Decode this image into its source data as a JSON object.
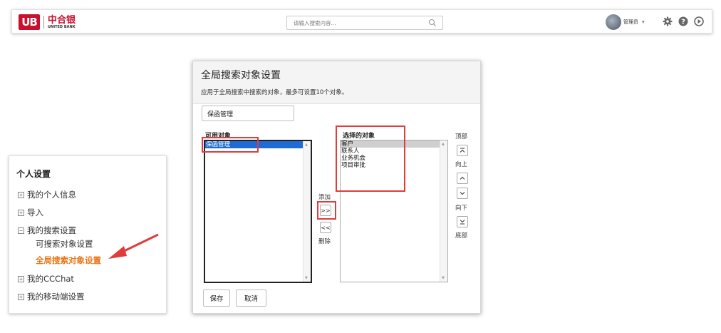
{
  "header": {
    "logo_mark": "UB",
    "logo_cn": "中合银",
    "logo_en": "UNITED BANK",
    "search_placeholder": "请输入搜索内容...",
    "user_label": "管理员",
    "icons": [
      "search-icon",
      "gear-icon",
      "help-icon",
      "play-circle-icon"
    ]
  },
  "sidebar": {
    "title": "个人设置",
    "items": [
      {
        "label": "我的个人信息",
        "toggle": "⊞"
      },
      {
        "label": "导入",
        "toggle": "⊞"
      },
      {
        "label": "我的搜索设置",
        "toggle": "⊟",
        "children": [
          {
            "label": "可搜索对象设置"
          },
          {
            "label": "全局搜索对象设置",
            "active": true
          }
        ]
      },
      {
        "label": "我的CCChat",
        "toggle": "⊞"
      },
      {
        "label": "我的移动端设置",
        "toggle": "⊞"
      }
    ],
    "active_color": "#e8761a"
  },
  "dialog": {
    "title": "全局搜索对象设置",
    "description": "应用于全局搜索中搜索的对象，最多可设置10个对象。",
    "filter_value": "保函管理",
    "available_label": "可用对象",
    "available_items": [
      "保函管理"
    ],
    "selected_label": "选择的对象",
    "selected_items": [
      "客户",
      "联系人",
      "业务机会",
      "项目审批"
    ],
    "add_label": "添加",
    "add_symbol": ">>",
    "remove_symbol": "<<",
    "remove_label": "删除",
    "top_label": "顶部",
    "up_label": "向上",
    "down_label": "向下",
    "bottom_label": "底部",
    "save_label": "保存",
    "cancel_label": "取消"
  },
  "colors": {
    "brand_red": "#c8102e",
    "highlight_red": "#e03c3c",
    "selection_blue": "#1e6bd6"
  }
}
